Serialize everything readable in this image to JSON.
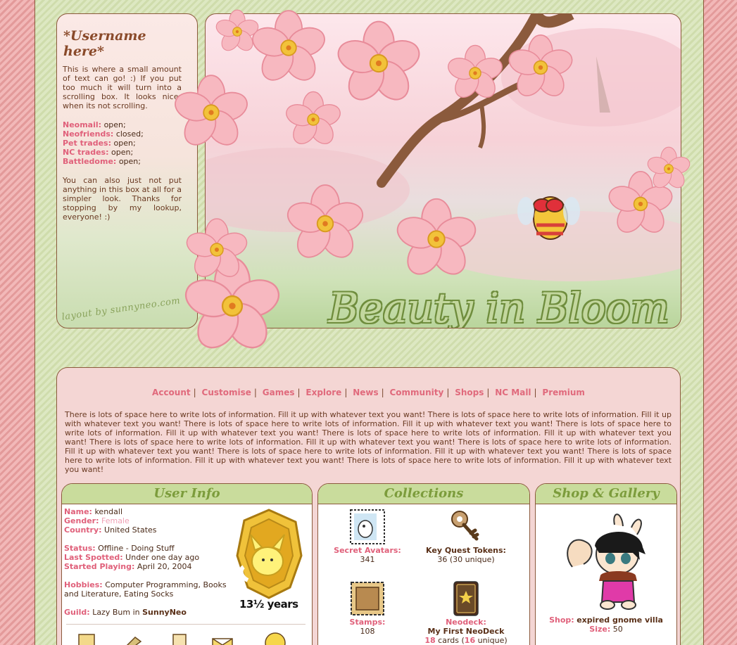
{
  "header": {
    "username": "*Username here*",
    "intro": "This is where a small amount of text can go! :) If you put too much it will turn into a scrolling box. It looks nicer when its not scrolling.",
    "statuses": [
      {
        "label": "Neomail:",
        "value": "open;"
      },
      {
        "label": "Neofriends:",
        "value": "closed;"
      },
      {
        "label": "Pet trades:",
        "value": "open;"
      },
      {
        "label": "NC trades:",
        "value": "open;"
      },
      {
        "label": "Battledome:",
        "value": "open;"
      }
    ],
    "outro": "You can also just not put anything in this box at all for a simpler look. Thanks for stopping by my lookup, everyone! :)",
    "credit": "layout by sunnyneo.com",
    "banner_title": "Beauty in Bloom"
  },
  "nav": [
    "Account",
    "Customise",
    "Games",
    "Explore",
    "News",
    "Community",
    "Shops",
    "NC Mall",
    "Premium"
  ],
  "bio": "There is lots of space here to write lots of information. Fill it up with whatever text you want! There is lots of space here to write lots of information. Fill it up with whatever text you want! There is lots of space here to write lots of information. Fill it up with whatever text you want! There is lots of space here to write lots of information. Fill it up with whatever text you want! There is lots of space here to write lots of information. Fill it up with whatever text you want! There is lots of space here to write lots of information. Fill it up with whatever text you want! There is lots of space here to write lots of information. Fill it up with whatever text you want! There is lots of space here to write lots of information. Fill it up with whatever text you want! There is lots of space here to write lots of information. Fill it up with whatever text you want! There is lots of space here to write lots of information. Fill it up with whatever text you want!",
  "user_info": {
    "title": "User Info",
    "name_label": "Name:",
    "name": "kendall",
    "gender_label": "Gender:",
    "gender": "Female",
    "country_label": "Country:",
    "country": "United States",
    "status_label": "Status:",
    "status": "Offline - Doing Stuff",
    "last_label": "Last Spotted:",
    "last": "Under one day ago",
    "started_label": "Started Playing:",
    "started": "April 20, 2004",
    "hobbies_label": "Hobbies:",
    "hobbies": "Computer Programming, Books and Literature, Eating Socks",
    "guild_label": "Guild:",
    "guild_prefix": "Lazy Bum in",
    "guild": "SunnyNeo",
    "years": "13½ years"
  },
  "collections": {
    "title": "Collections",
    "avatars_label": "Secret Avatars:",
    "avatars": "341",
    "tokens_label": "Key Quest Tokens:",
    "tokens": "36 (30 unique)",
    "stamps_label": "Stamps:",
    "stamps": "108",
    "neodeck_label": "Neodeck:",
    "neodeck_name": "My First NeoDeck",
    "cards_count": "18",
    "cards_word": "cards (",
    "cards_unique": "16",
    "cards_unique_word": "unique)"
  },
  "shop": {
    "title": "Shop & Gallery",
    "shop_label": "Shop:",
    "shop_name": "expired gnome villa",
    "size_label": "Size:",
    "size": "50"
  },
  "colors": {
    "accent_pink": "#e0607a",
    "header_green": "#c9dc9c",
    "title_green": "#7c9c3c",
    "border_brown": "#8b5a3c",
    "content_pink": "#f4d6d4"
  }
}
